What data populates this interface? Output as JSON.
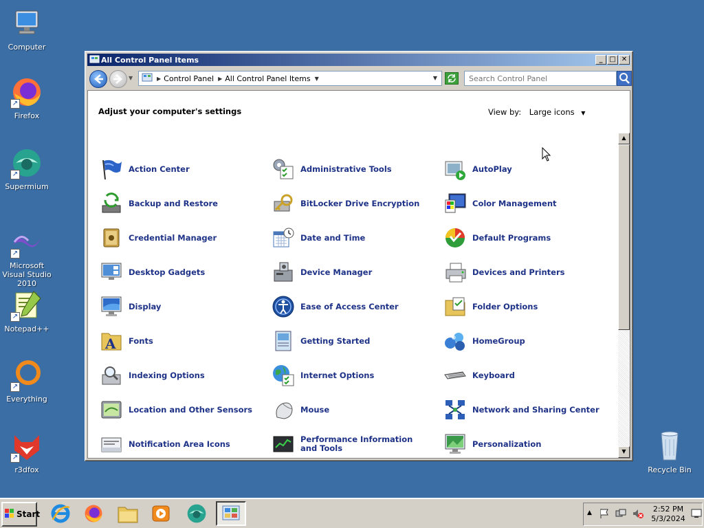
{
  "desktop": {
    "icons": [
      {
        "label": "Computer"
      },
      {
        "label": "Firefox"
      },
      {
        "label": "Supermium"
      },
      {
        "label": "Microsoft Visual Studio 2010"
      },
      {
        "label": "Notepad++"
      },
      {
        "label": "Everything"
      },
      {
        "label": "r3dfox"
      },
      {
        "label": "Recycle Bin"
      }
    ]
  },
  "window": {
    "title": "All Control Panel Items",
    "address": {
      "crumbs": [
        "Control Panel",
        "All Control Panel Items"
      ]
    },
    "search": {
      "placeholder": "Search Control Panel"
    },
    "heading": "Adjust your computer's settings",
    "view_by": {
      "label": "View by:",
      "value": "Large icons"
    },
    "items": [
      {
        "label": "Action Center",
        "icon": "flag-icon"
      },
      {
        "label": "Administrative Tools",
        "icon": "admin-tools-icon"
      },
      {
        "label": "AutoPlay",
        "icon": "autoplay-icon"
      },
      {
        "label": "Backup and Restore",
        "icon": "backup-icon"
      },
      {
        "label": "BitLocker Drive Encryption",
        "icon": "bitlocker-key-icon"
      },
      {
        "label": "Color Management",
        "icon": "color-management-icon"
      },
      {
        "label": "Credential Manager",
        "icon": "vault-icon"
      },
      {
        "label": "Date and Time",
        "icon": "calendar-clock-icon"
      },
      {
        "label": "Default Programs",
        "icon": "default-programs-icon"
      },
      {
        "label": "Desktop Gadgets",
        "icon": "gadgets-icon"
      },
      {
        "label": "Device Manager",
        "icon": "device-manager-icon"
      },
      {
        "label": "Devices and Printers",
        "icon": "printer-icon"
      },
      {
        "label": "Display",
        "icon": "monitor-icon"
      },
      {
        "label": "Ease of Access Center",
        "icon": "ease-of-access-icon"
      },
      {
        "label": "Folder Options",
        "icon": "folder-icon"
      },
      {
        "label": "Fonts",
        "icon": "fonts-icon"
      },
      {
        "label": "Getting Started",
        "icon": "getting-started-icon"
      },
      {
        "label": "HomeGroup",
        "icon": "homegroup-icon"
      },
      {
        "label": "Indexing Options",
        "icon": "indexing-icon"
      },
      {
        "label": "Internet Options",
        "icon": "globe-icon"
      },
      {
        "label": "Keyboard",
        "icon": "keyboard-icon"
      },
      {
        "label": "Location and Other Sensors",
        "icon": "sensor-icon"
      },
      {
        "label": "Mouse",
        "icon": "mouse-icon"
      },
      {
        "label": "Network and Sharing Center",
        "icon": "network-icon"
      },
      {
        "label": "Notification Area Icons",
        "icon": "notification-icon"
      },
      {
        "label": "Performance Information and Tools",
        "icon": "performance-icon"
      },
      {
        "label": "Personalization",
        "icon": "personalization-icon"
      }
    ]
  },
  "taskbar": {
    "start_label": "Start",
    "clock": {
      "time": "2:52 PM",
      "date": "5/3/2024"
    }
  },
  "colors": {
    "desktop": "#3a6ea5",
    "link": "#1e3287",
    "titlebar_start": "#0a246a",
    "titlebar_end": "#a6caf0"
  }
}
